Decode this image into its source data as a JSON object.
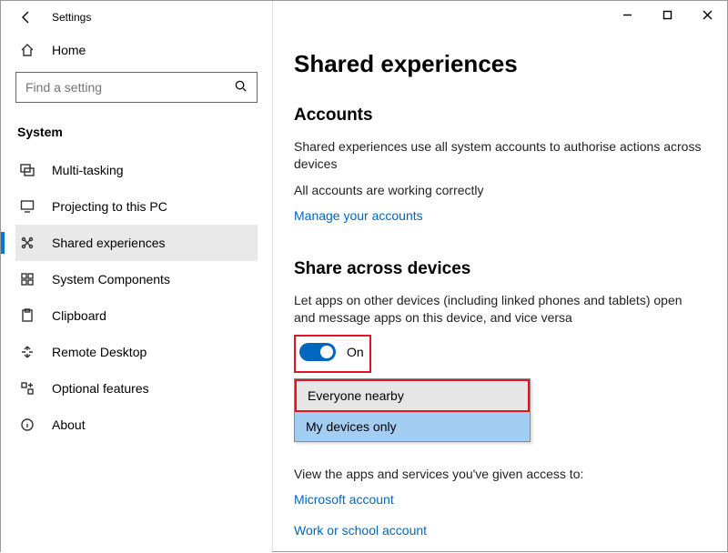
{
  "titlebar": {
    "title": "Settings"
  },
  "sidebar": {
    "home": "Home",
    "search_placeholder": "Find a setting",
    "section": "System",
    "items": [
      {
        "label": "Multi-tasking"
      },
      {
        "label": "Projecting to this PC"
      },
      {
        "label": "Shared experiences"
      },
      {
        "label": "System Components"
      },
      {
        "label": "Clipboard"
      },
      {
        "label": "Remote Desktop"
      },
      {
        "label": "Optional features"
      },
      {
        "label": "About"
      }
    ]
  },
  "main": {
    "title": "Shared experiences",
    "accounts_heading": "Accounts",
    "accounts_desc": "Shared experiences use all system accounts to authorise actions across devices",
    "accounts_status": "All accounts are working correctly",
    "manage_link": "Manage your accounts",
    "share_heading": "Share across devices",
    "share_desc": "Let apps on other devices (including linked phones and tablets) open and message apps on this device, and vice versa",
    "toggle_state": "On",
    "dropdown_option1": "Everyone nearby",
    "dropdown_option2": "My devices only",
    "view_access": "View the apps and services you've given access to:",
    "ms_account_link": "Microsoft account",
    "work_account_link": "Work or school account"
  }
}
